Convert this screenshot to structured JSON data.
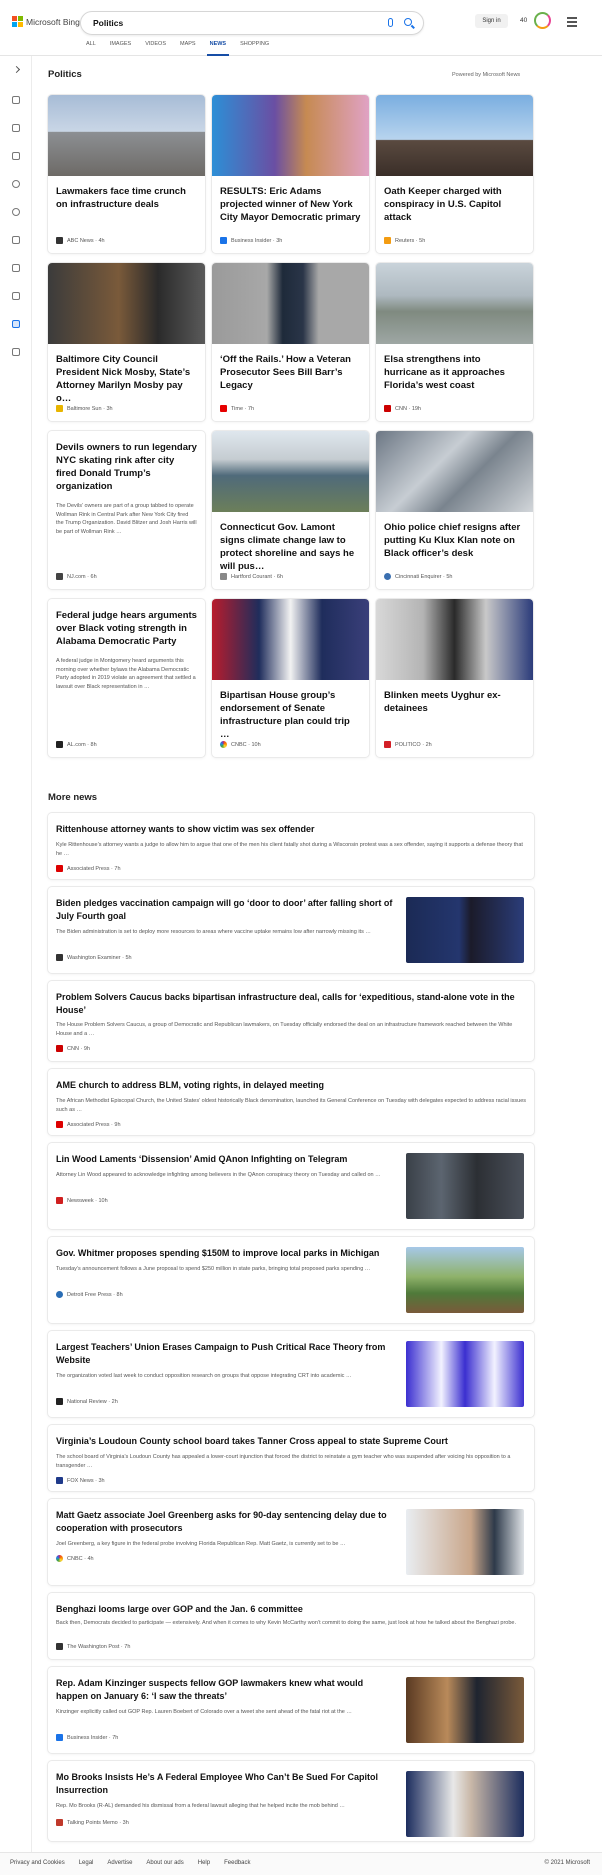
{
  "header": {
    "brand": "Microsoft Bing",
    "query": "Politics",
    "signin": "Sign in",
    "points": "40",
    "tabs": [
      "ALL",
      "IMAGES",
      "VIDEOS",
      "MAPS",
      "NEWS",
      "SHOPPING"
    ],
    "active_tab": "NEWS"
  },
  "sidebar": {
    "icons": [
      "chevron-right-icon",
      "home-icon",
      "flask-icon",
      "flag-icon",
      "pin-icon",
      "globe-icon",
      "trophy-icon",
      "rocket-icon",
      "film-icon",
      "briefcase-icon",
      "car-icon"
    ]
  },
  "section": {
    "title": "Politics",
    "powered": "Powered by Microsoft News"
  },
  "cards": [
    {
      "title": "Lawmakers face time crunch on infrastructure deals",
      "source": "ABC News",
      "time": "4h"
    },
    {
      "title": "RESULTS: Eric Adams projected winner of New York City Mayor Democratic primary",
      "source": "Business Insider",
      "time": "3h"
    },
    {
      "title": "Oath Keeper charged with conspiracy in U.S. Capitol attack",
      "source": "Reuters",
      "time": "5h"
    },
    {
      "title": "Baltimore City Council President Nick Mosby, State’s Attorney Marilyn Mosby pay o…",
      "source": "Baltimore Sun",
      "time": "3h"
    },
    {
      "title": "‘Off the Rails.’ How a Veteran Prosecutor Sees Bill Barr’s Legacy",
      "source": "Time",
      "time": "7h"
    },
    {
      "title": "Elsa strengthens into hurricane as it approaches Florida’s west coast",
      "source": "CNN",
      "time": "19h"
    },
    {
      "title": "Devils owners to run legendary NYC skating rink after city fired Donald Trump’s organization",
      "desc": "The Devils’ owners are part of a group tabbed to operate Wollman Rink in Central Park after New York City fired the Trump Organization. David Blitzer and Josh Harris will be part of Wollman Rink …",
      "source": "NJ.com",
      "time": "6h"
    },
    {
      "title": "Connecticut Gov. Lamont signs climate change law to protect shoreline and says he will pus…",
      "source": "Hartford Courant",
      "time": "6h"
    },
    {
      "title": "Ohio police chief resigns after putting Ku Klux Klan note on Black officer’s desk",
      "source": "Cincinnati Enquirer",
      "time": "5h"
    },
    {
      "title": "Federal judge hears arguments over Black voting strength in Alabama Democratic Party",
      "desc": "A federal judge in Montgomery heard arguments this morning over whether bylaws the Alabama Democratic Party adopted in 2019 violate an agreement that settled a lawsuit over Black representation in …",
      "source": "AL.com",
      "time": "8h"
    },
    {
      "title": "Bipartisan House group’s endorsement of Senate infrastructure plan could trip …",
      "source": "CNBC",
      "time": "10h"
    },
    {
      "title": "Blinken meets Uyghur ex-detainees",
      "source": "POLITICO",
      "time": "2h"
    }
  ],
  "more": {
    "title": "More news",
    "items": [
      {
        "title": "Rittenhouse attorney wants to show victim was sex offender",
        "desc": "Kyle Rittenhouse’s attorney wants a judge to allow him to argue that one of the men his client fatally shot during a Wisconsin protest was a sex offender, saying it supports a defense theory that he …",
        "source": "Associated Press",
        "time": "7h"
      },
      {
        "title": "Biden pledges vaccination campaign will go ‘door to door’ after falling short of July Fourth goal",
        "desc": "The Biden administration is set to deploy more resources to areas where vaccine uptake remains low after narrowly missing its …",
        "source": "Washington Examiner",
        "time": "5h"
      },
      {
        "title": "Problem Solvers Caucus backs bipartisan infrastructure deal, calls for ‘expeditious, stand-alone vote in the House’",
        "desc": "The House Problem Solvers Caucus, a group of Democratic and Republican lawmakers, on Tuesday officially endorsed the deal on an infrastructure framework reached between the White House and a …",
        "source": "CNN",
        "time": "9h"
      },
      {
        "title": "AME church to address BLM, voting rights, in delayed meeting",
        "desc": "The African Methodist Episcopal Church, the United States’ oldest historically Black denomination, launched its General Conference on Tuesday with delegates expected to address racial issues such as …",
        "source": "Associated Press",
        "time": "9h"
      },
      {
        "title": "Lin Wood Laments ‘Dissension’ Amid QAnon Infighting on Telegram",
        "desc": "Attorney Lin Wood appeared to acknowledge infighting among believers in the QAnon conspiracy theory on Tuesday and called on …",
        "source": "Newsweek",
        "time": "10h"
      },
      {
        "title": "Gov. Whitmer proposes spending $150M to improve local parks in Michigan",
        "desc": "Tuesday’s announcement follows a June proposal to spend $250 million in state parks, bringing total proposed parks spending …",
        "source": "Detroit Free Press",
        "time": "8h"
      },
      {
        "title": "Largest Teachers’ Union Erases Campaign to Push Critical Race Theory from Website",
        "desc": "The organization voted last week to conduct opposition research on groups that oppose integrating CRT into academic …",
        "source": "National Review",
        "time": "2h"
      },
      {
        "title": "Virginia’s Loudoun County school board takes Tanner Cross appeal to state Supreme Court",
        "desc": "The school board of Virginia’s Loudoun County has appealed a lower-court injunction that forced the district to reinstate a gym teacher who was suspended after voicing his opposition to a transgender …",
        "source": "FOX News",
        "time": "3h"
      },
      {
        "title": "Matt Gaetz associate Joel Greenberg asks for 90-day sentencing delay due to cooperation with prosecutors",
        "desc": "Joel Greenberg, a key figure in the federal probe involving Florida Republican Rep. Matt Gaetz, is currently set to be …",
        "source": "CNBC",
        "time": "4h"
      },
      {
        "title": "Benghazi looms large over GOP and the Jan. 6 committee",
        "desc": "Back then, Democrats decided to participate — extensively. And when it comes to why Kevin McCarthy won’t commit to doing the same, just look at how he talked about the Benghazi probe.",
        "source": "The Washington Post",
        "time": "7h"
      },
      {
        "title": "Rep. Adam Kinzinger suspects fellow GOP lawmakers knew what would happen on January 6: ‘I saw the threats’",
        "desc": "Kinzinger explicitly called out GOP Rep. Lauren Boebert of Colorado over a tweet she sent ahead of the fatal riot at the …",
        "source": "Business Insider",
        "time": "7h"
      },
      {
        "title": "Mo Brooks Insists He’s A Federal Employee Who Can’t Be Sued For Capitol Insurrection",
        "desc": "Rep. Mo Brooks (R-AL) demanded his dismissal from a federal lawsuit alleging that he helped incite the mob behind …",
        "source": "Talking Points Memo",
        "time": "3h"
      }
    ]
  },
  "footer": {
    "links": [
      "Privacy and Cookies",
      "Legal",
      "Advertise",
      "About our ads",
      "Help",
      "Feedback"
    ],
    "copyright": "© 2021 Microsoft"
  }
}
